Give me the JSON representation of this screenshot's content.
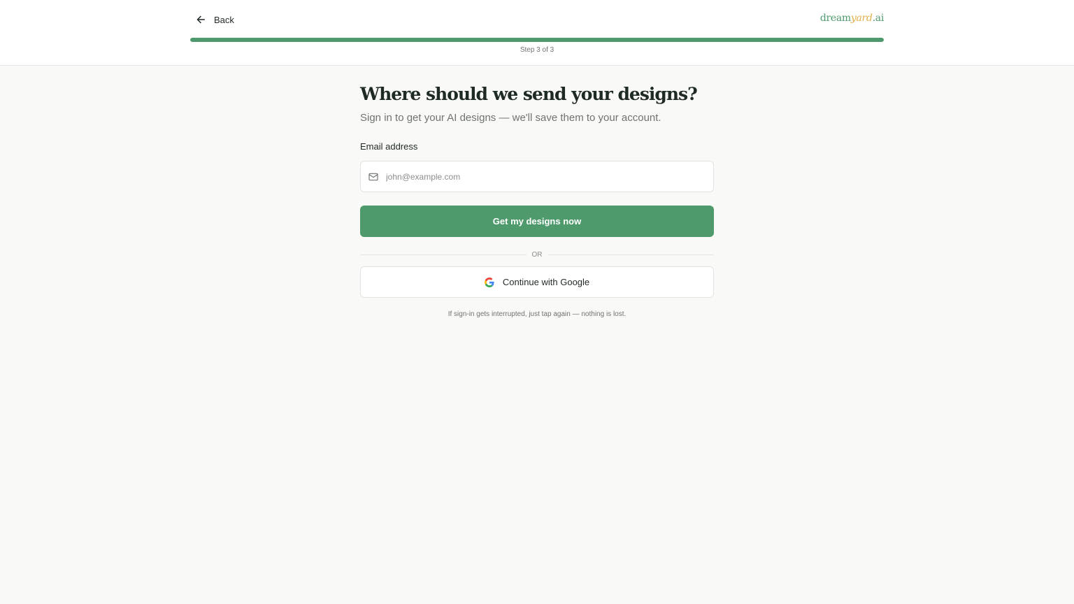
{
  "header": {
    "back_label": "Back",
    "logo": {
      "part1": "dream",
      "part2": "yard",
      "part3": ".ai"
    },
    "progress_percent": 100,
    "step_text": "Step 3 of 3"
  },
  "main": {
    "title": "Where should we send your designs?",
    "subtitle": "Sign in to get your AI designs — we'll save them to your account.",
    "email_label": "Email address",
    "email_placeholder": "john@example.com",
    "email_value": "",
    "primary_button": "Get my designs now",
    "divider_text": "OR",
    "google_button": "Continue with Google",
    "note": "If sign-in gets interrupted, just tap again — nothing is lost."
  },
  "colors": {
    "accent": "#4e9a6c",
    "logo_highlight": "#e0b04a",
    "background": "#f9f9f7"
  },
  "icons": {
    "back": "arrow-left-icon",
    "email": "mail-icon",
    "google": "google-icon"
  }
}
